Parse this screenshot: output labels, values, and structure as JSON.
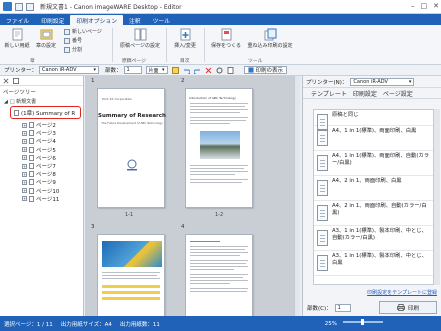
{
  "window": {
    "title": "新規文書1 - Canon imageWARE Desktop - Editor",
    "controls": [
      "–",
      "□",
      "✕"
    ]
  },
  "tabs": [
    "ファイル",
    "印刷設定",
    "印刷オプション",
    "注釈",
    "ツール"
  ],
  "active_tab": 2,
  "ribbon": {
    "new_page": "新しい用紙",
    "page_settings": "章の設定",
    "template_small": [
      "新しいページ",
      "番号",
      "分割"
    ],
    "page_layout": "原稿ページの設定",
    "insert_page": "挿入/変更",
    "save_doc": "保存をつくる",
    "save_print": "重ね込み印刷の設定",
    "group_labels": [
      "章",
      "原稿ページ",
      "目次",
      "ツール"
    ]
  },
  "toolbar2": {
    "printer_label": "プリンター：",
    "printer_value": "Canon iR-ADV",
    "copies_label": "部数：",
    "copies_value": "1",
    "sides_value": "片面",
    "preview_label": "印刷の表示"
  },
  "left_pane": {
    "title": "ページツリー",
    "root_label": "□ 新規文書",
    "selected_item": "(1章) Summary of R",
    "pages": [
      "ページ2",
      "ページ3",
      "ページ4",
      "ページ5",
      "ページ6",
      "ページ7",
      "ページ8",
      "ページ9",
      "ページ10",
      "ページ11"
    ]
  },
  "center": {
    "page_numbers": [
      "1",
      "2",
      "3",
      "4"
    ],
    "captions": [
      "1-1",
      "1-2"
    ],
    "thumb1": {
      "header": "Prof. XX Corporation",
      "title": "Summary of Research",
      "subtitle": "The Future Development of ABC Technology"
    },
    "thumb2": {
      "header": "Introduction of ABC Technology"
    }
  },
  "right_pane": {
    "printer_label": "プリンター(N)：",
    "printer_value": "Canon iR-ADV",
    "tabs": [
      "テンプレート",
      "印刷設定",
      "ページ設定"
    ],
    "templates": [
      "原稿と同じ",
      "A4、1 in 1(標準)、両面印刷、白黒",
      "A4、1 in 1(標準)、両面印刷、自動(カラー/白黒)",
      "A4、2 in 1、両面印刷、白黒",
      "A4、2 in 1、両面印刷、自動(カラー/白黒)",
      "A3、1 in 1(標準)、製本印刷、中とじ、自動(カラー/白黒)",
      "A3、1 in 1(標準)、製本印刷、中とじ、白黒"
    ],
    "register_link": "印刷設定をテンプレートに登録",
    "copies_label": "部数(C)：",
    "copies_value": "1",
    "print_button": "印刷"
  },
  "statusbar": {
    "selected_page": "選択ページ：1 / 11",
    "output_size": "出力用紙サイズ：A4",
    "output_count": "出力用紙数：11",
    "zoom": "25%"
  }
}
